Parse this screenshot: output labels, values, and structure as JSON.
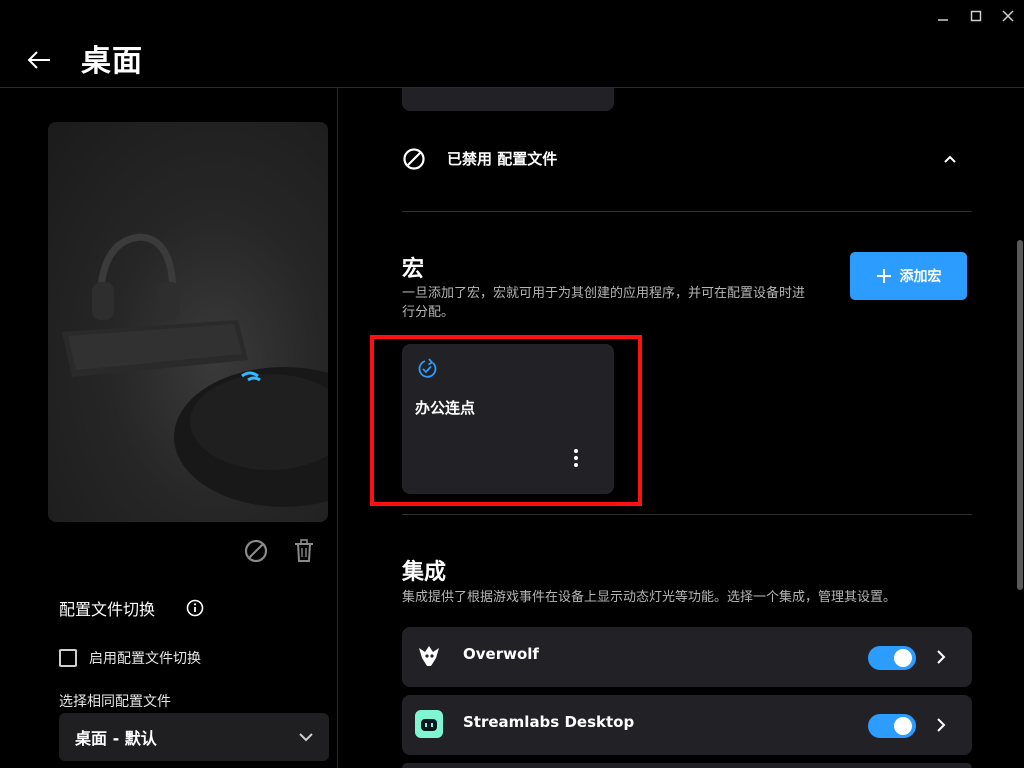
{
  "window": {
    "controls": [
      "minimize",
      "maximize",
      "close"
    ]
  },
  "header": {
    "title": "桌面",
    "back_icon": "arrow-left-icon"
  },
  "left_panel": {
    "profile_switch_title": "配置文件切换",
    "enable_switch_label": "启用配置文件切换",
    "enable_switch_checked": false,
    "select_label": "选择相同配置文件",
    "select_value": "桌面 - 默认"
  },
  "main": {
    "disabled_profile_text": "已禁用 配置文件",
    "macros": {
      "title": "宏",
      "description": "一旦添加了宏，宏就可用于为其创建的应用程序，并可在配置设备时进行分配。",
      "add_button_label": "添加宏",
      "items": [
        {
          "name": "办公连点",
          "icon": "repeat-check-icon"
        }
      ]
    },
    "integrations": {
      "title": "集成",
      "description": "集成提供了根据游戏事件在设备上显示动态灯光等功能。选择一个集成，管理其设置。",
      "items": [
        {
          "name": "Overwolf",
          "icon": "overwolf-logo-icon",
          "enabled": true
        },
        {
          "name": "Streamlabs Desktop",
          "icon": "streamlabs-logo-icon",
          "enabled": true
        }
      ]
    }
  },
  "colors": {
    "accent": "#2d9cff",
    "highlight": "#ff1010",
    "card": "#222226",
    "background": "#000000"
  }
}
